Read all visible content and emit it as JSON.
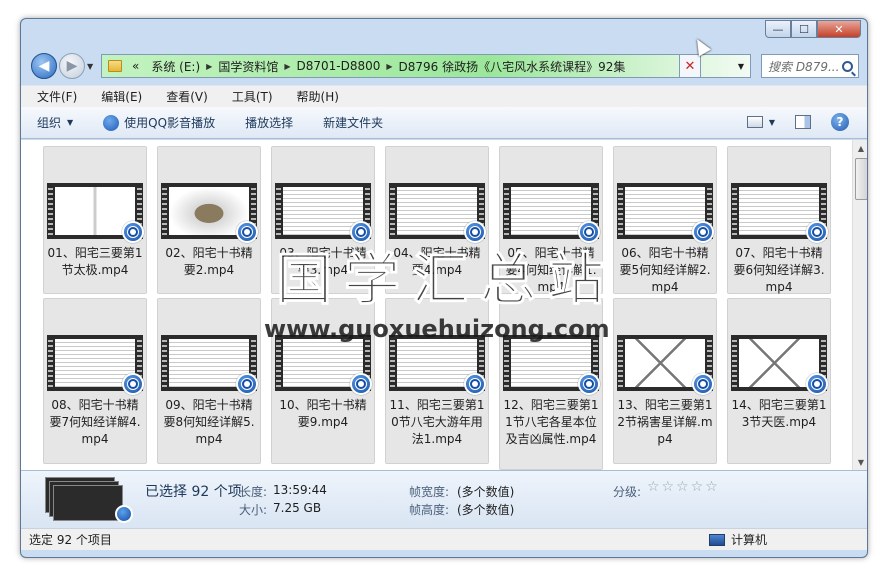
{
  "window": {
    "controls": {
      "minimize": "—",
      "maximize": "☐",
      "close": "✕"
    }
  },
  "address": {
    "overflow": "«",
    "crumbs": [
      "系统 (E:)",
      "国学资料馆",
      "D8701-D8800",
      "D8796 徐政扬《八宅风水系统课程》92集"
    ]
  },
  "search": {
    "placeholder": "搜索 D879..."
  },
  "menu": [
    "文件(F)",
    "编辑(E)",
    "查看(V)",
    "工具(T)",
    "帮助(H)"
  ],
  "toolbar": {
    "organize": "组织",
    "qq_play": "使用QQ影音播放",
    "play_selection": "播放选择",
    "new_folder": "新建文件夹",
    "help": "?"
  },
  "files": [
    "01、阳宅三要第1节太极.mp4",
    "02、阳宅十书精要2.mp4",
    "03、阳宅十书精要3.mp4",
    "04、阳宅十书精要4.mp4",
    "05、阳宅十书精要4何知经详解1.mp4",
    "06、阳宅十书精要5何知经详解2.mp4",
    "07、阳宅十书精要6何知经详解3.mp4",
    "08、阳宅十书精要7何知经详解4.mp4",
    "09、阳宅十书精要8何知经详解5.mp4",
    "10、阳宅十书精要9.mp4",
    "11、阳宅三要第10节八宅大游年用法1.mp4",
    "12、阳宅三要第11节八宅各星本位及吉凶属性.mp4",
    "13、阳宅三要第12节祸害星详解.mp4",
    "14、阳宅三要第13节天医.mp4"
  ],
  "watermark": {
    "cn": "国学汇总站",
    "url": "www.guoxuehuizong.com"
  },
  "details": {
    "selected": "已选择 92 个项",
    "length_label": "长度:",
    "length_value": "13:59:44",
    "size_label": "大小:",
    "size_value": "7.25 GB",
    "frame_width_label": "帧宽度:",
    "frame_width_value": "(多个数值)",
    "frame_height_label": "帧高度:",
    "frame_height_value": "(多个数值)",
    "rating_label": "分级:",
    "rating_stars": "☆☆☆☆☆"
  },
  "status": {
    "left": "选定 92 个项目",
    "right": "计算机"
  }
}
